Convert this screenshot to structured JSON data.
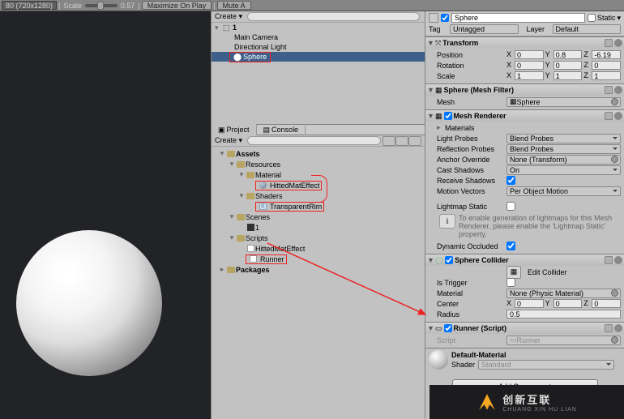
{
  "toolbar": {
    "resolution": "80 (720x1280)",
    "scale_label": "Scale",
    "scale_value": "0.57",
    "maximize": "Maximize On Play",
    "mute": "Mute A"
  },
  "hierarchy": {
    "create": "Create",
    "search_placeholder": "",
    "root": "1",
    "items": [
      "Main Camera",
      "Directional Light",
      "Sphere"
    ]
  },
  "project": {
    "tab_project": "Project",
    "tab_console": "Console",
    "create": "Create",
    "tree": {
      "assets": "Assets",
      "resources": "Resources",
      "material": "Material",
      "mat_item": "HittedMatEffect",
      "shaders": "Shaders",
      "shader_item": "TransparentRim",
      "scenes": "Scenes",
      "scene_item": "1",
      "scripts": "Scripts",
      "cs1": "HittedMatEffect",
      "cs2": "Runner",
      "packages": "Packages"
    }
  },
  "inspector": {
    "go_name": "Sphere",
    "static_label": "Static",
    "tag_label": "Tag",
    "tag_value": "Untagged",
    "layer_label": "Layer",
    "layer_value": "Default",
    "transform": {
      "title": "Transform",
      "position": "Position",
      "rotation": "Rotation",
      "scale": "Scale",
      "pos": {
        "x": "0",
        "y": "0.8",
        "z": "-6.19"
      },
      "rot": {
        "x": "0",
        "y": "0",
        "z": "0"
      },
      "scl": {
        "x": "1",
        "y": "1",
        "z": "1"
      }
    },
    "mesh_filter": {
      "title": "Sphere (Mesh Filter)",
      "mesh_label": "Mesh",
      "mesh_value": "Sphere"
    },
    "renderer": {
      "title": "Mesh Renderer",
      "materials": "Materials",
      "light_probes_l": "Light Probes",
      "light_probes_v": "Blend Probes",
      "reflection_l": "Reflection Probes",
      "reflection_v": "Blend Probes",
      "anchor_l": "Anchor Override",
      "anchor_v": "None (Transform)",
      "cast_l": "Cast Shadows",
      "cast_v": "On",
      "recv_l": "Receive Shadows",
      "motion_l": "Motion Vectors",
      "motion_v": "Per Object Motion",
      "lightmap_l": "Lightmap Static",
      "info": "To enable generation of lightmaps for this Mesh Renderer, please enable the 'Lightmap Static' property.",
      "dynocc_l": "Dynamic Occluded"
    },
    "collider": {
      "title": "Sphere Collider",
      "edit_btn": "Edit Collider",
      "trigger_l": "Is Trigger",
      "material_l": "Material",
      "material_v": "None (Physic Material)",
      "center_l": "Center",
      "center": {
        "x": "0",
        "y": "0",
        "z": "0"
      },
      "radius_l": "Radius",
      "radius_v": "0.5"
    },
    "runner": {
      "title": "Runner (Script)",
      "script_l": "Script",
      "script_v": "Runner"
    },
    "default_mat": {
      "name": "Default-Material",
      "shader_l": "Shader",
      "shader_v": "Standard"
    },
    "add_component": "Add Component"
  },
  "footer": {
    "cn": "创新互联",
    "py": "CHUANG XIN HU LIAN"
  }
}
